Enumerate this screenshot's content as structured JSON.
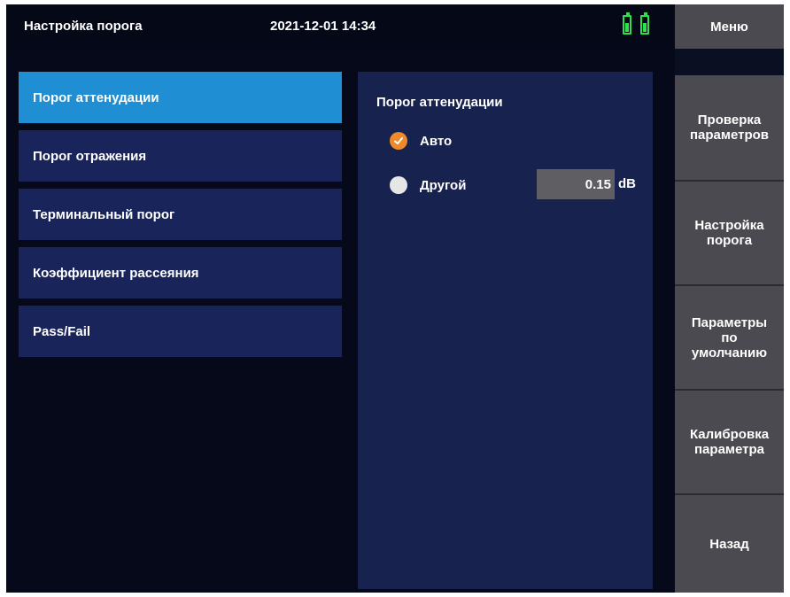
{
  "statusbar": {
    "title": "Настройка порога",
    "datetime": "2021-12-01 14:34",
    "battery_color": "#2fe04a"
  },
  "menu": {
    "header": "Меню",
    "buttons": [
      {
        "label": "Проверка\nпараметров"
      },
      {
        "label": "Настройка\nпорога"
      },
      {
        "label": "Параметры\nпо\nумолчанию"
      },
      {
        "label": "Калибровка\nпараметра"
      },
      {
        "label": "Назад"
      }
    ]
  },
  "left_list": {
    "items": [
      {
        "label": "Порог аттенудации",
        "active": true
      },
      {
        "label": "Порог отражения",
        "active": false
      },
      {
        "label": "Терминальный порог",
        "active": false
      },
      {
        "label": "Коэффициент рассеяния",
        "active": false
      },
      {
        "label": "Pass/Fail",
        "active": false
      }
    ]
  },
  "panel": {
    "title": "Порог аттенудации",
    "options": [
      {
        "label": "Авто",
        "checked": true
      },
      {
        "label": "Другой",
        "checked": false
      }
    ],
    "value": "0.15",
    "unit": "dB"
  },
  "colors": {
    "active_item": "#1f8ed2",
    "item_bg": "#18245a",
    "radio_checked": "#ef8a2a",
    "menu_button": "#4a4a50"
  }
}
